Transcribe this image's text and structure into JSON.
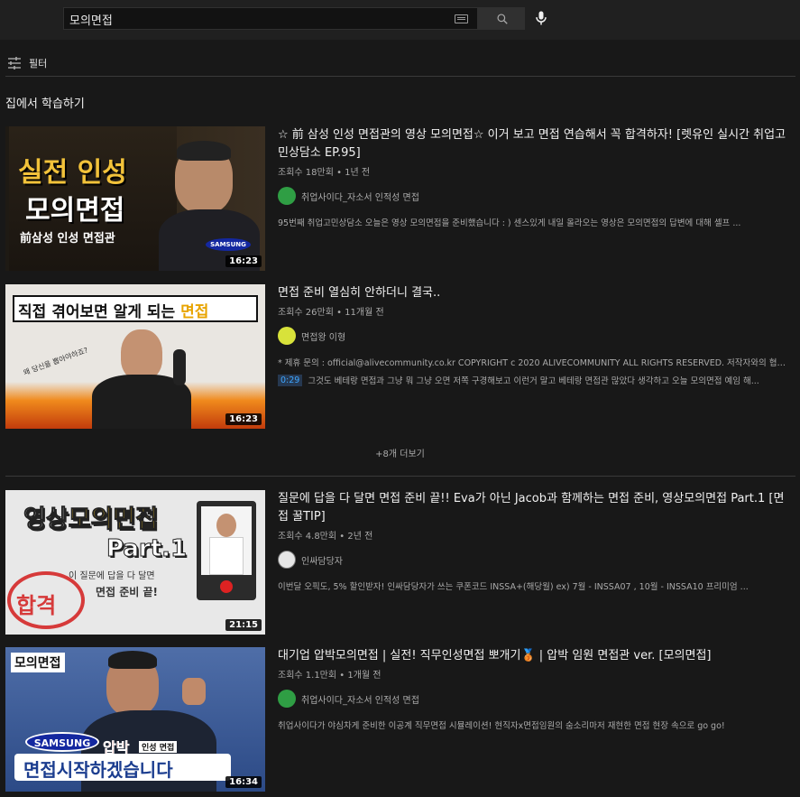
{
  "search": {
    "query": "모의면접"
  },
  "filter": {
    "label": "필터"
  },
  "section": {
    "title": "집에서 학습하기"
  },
  "more": {
    "label": "+8개 더보기"
  },
  "videos": [
    {
      "title": "☆ 前 삼성 인성 면접관의 영상 모의면접☆ 이거 보고 면접 연습해서 꼭 합격하자! [렛유인 실시간 취업고민상담소 EP.95]",
      "meta": "조회수 18만회 • 1년 전",
      "channel": "취업사이다_자소서 인적성 면접",
      "desc": "95번째 취업고민상담소 오늘은 영상 모의면접을 준비했습니다 : ) 센스있게 내일 올라오는 영상은 모의면접의 답변에 대해 셀프 ...",
      "duration": "16:23",
      "thumb": {
        "line1": "실전 인성",
        "line2": "모의면접",
        "line3": "前삼성 인성 면접관",
        "badge": "SAMSUNG"
      }
    },
    {
      "title": "면접 준비 열심히 안하더니 결국..",
      "meta": "조회수 26만회 • 11개월 전",
      "channel": "면접왕 이형",
      "desc": "* 제휴 문의 : official@alivecommunity.co.kr COPYRIGHT c 2020 ALIVECOMMUNITY ALL RIGHTS RESERVED. 저작자와의 협의 ...",
      "chapter_ts": "0:29",
      "chapter_text": "그것도 베테랑 면접과 그냥 뭐 그냥 오면 저쪽 구경해보고 이런거 말고 베테랑 면접관 많았다 생각하고 오늘 모의면접 예임 해...",
      "duration": "16:23",
      "thumb": {
        "line1a": "직접 겪어보면 알게 되는 ",
        "line1b": "면접",
        "note": "왜 당신을 뽑아야하죠?"
      }
    },
    {
      "title": "질문에 답을 다 달면 면접 준비 끝!! Eva가 아닌 Jacob과 함께하는 면접 준비, 영상모의면접 Part.1 [면접 꿀TIP]",
      "meta": "조회수 4.8만회 • 2년 전",
      "channel": "인싸담당자",
      "desc": "이번달 오픽도, 5% 할인받자! 인싸담당자가 쓰는 쿠폰코드 INSSA+(해당월) ex) 7월 - INSSA07 , 10월 - INSSA10 프리미엄 ...",
      "duration": "21:15",
      "thumb": {
        "line1a": "영상",
        "line1b": "모의면접",
        "line2": "Part.1",
        "line3": "이 질문에 답을 다 달면",
        "line4": "면접 준비 끝!",
        "stamp": "합격"
      }
    },
    {
      "title": "대기업 압박모의면접 | 실전! 직무인성면접 뽀개기🥉 | 압박 임원 면접관 ver. [모의면접]",
      "meta": "조회수 1.1만회 • 1개월 전",
      "channel": "취업사이다_자소서 인적성 면접",
      "desc": "취업사이다가 야심차게 준비한 이공계 직무면접 시뮬레이션! 현직자x면접임원의 숨소리마저 재현한 면접 현장 속으로 go go!",
      "duration": "16:34",
      "thumb": {
        "tag": "모의면접",
        "badge": "SAMSUNG",
        "red": "압박",
        "small": "인성 면접",
        "bottom": "면접시작하겠습니다"
      }
    }
  ],
  "colors": {
    "bg": "#181818",
    "topbar": "#202020",
    "accent": "#3ea6ff"
  }
}
